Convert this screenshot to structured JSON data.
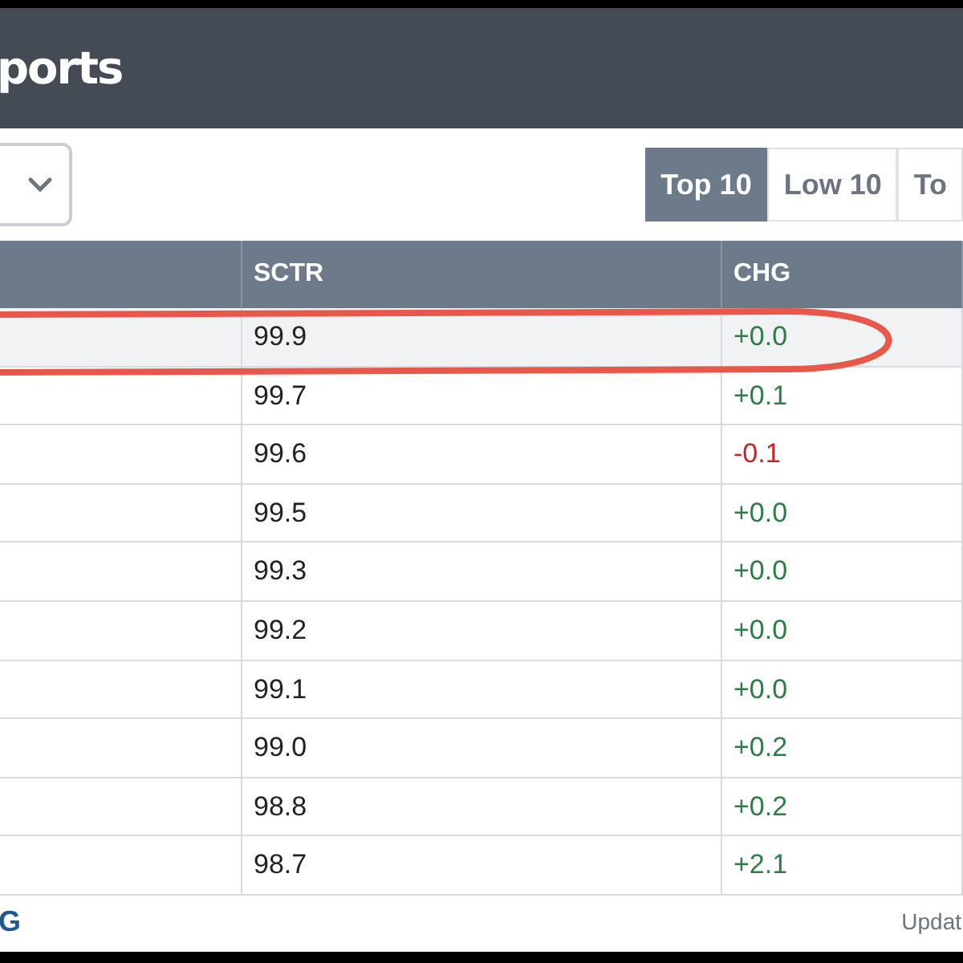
{
  "header": {
    "title": "ports"
  },
  "toolbar": {
    "tabs": [
      {
        "label": "Top 10",
        "selected": true
      },
      {
        "label": "Low 10",
        "selected": false
      },
      {
        "label": "To",
        "selected": false
      }
    ]
  },
  "table": {
    "columns": [
      "",
      "SCTR",
      "CHG"
    ],
    "rows": [
      {
        "sctr": "99.9",
        "chg": "+0.0",
        "color": "#2e7d46",
        "selected": true
      },
      {
        "sctr": "99.7",
        "chg": "+0.1",
        "color": "#2e7d46",
        "selected": false
      },
      {
        "sctr": "99.6",
        "chg": "-0.1",
        "color": "#c62828",
        "selected": false
      },
      {
        "sctr": "99.5",
        "chg": "+0.0",
        "color": "#2e7d46",
        "selected": false
      },
      {
        "sctr": "99.3",
        "chg": "+0.0",
        "color": "#2e7d46",
        "selected": false
      },
      {
        "sctr": "99.2",
        "chg": "+0.0",
        "color": "#2e7d46",
        "selected": false
      },
      {
        "sctr": "99.1",
        "chg": "+0.0",
        "color": "#2e7d46",
        "selected": false
      },
      {
        "sctr": "99.0",
        "chg": "+0.2",
        "color": "#2e7d46",
        "selected": false
      },
      {
        "sctr": "98.8",
        "chg": "+0.2",
        "color": "#2e7d46",
        "selected": false
      },
      {
        "sctr": "98.7",
        "chg": "+2.1",
        "color": "#2e7d46",
        "selected": false
      }
    ]
  },
  "footer": {
    "link": "G",
    "updated": "Updat"
  }
}
